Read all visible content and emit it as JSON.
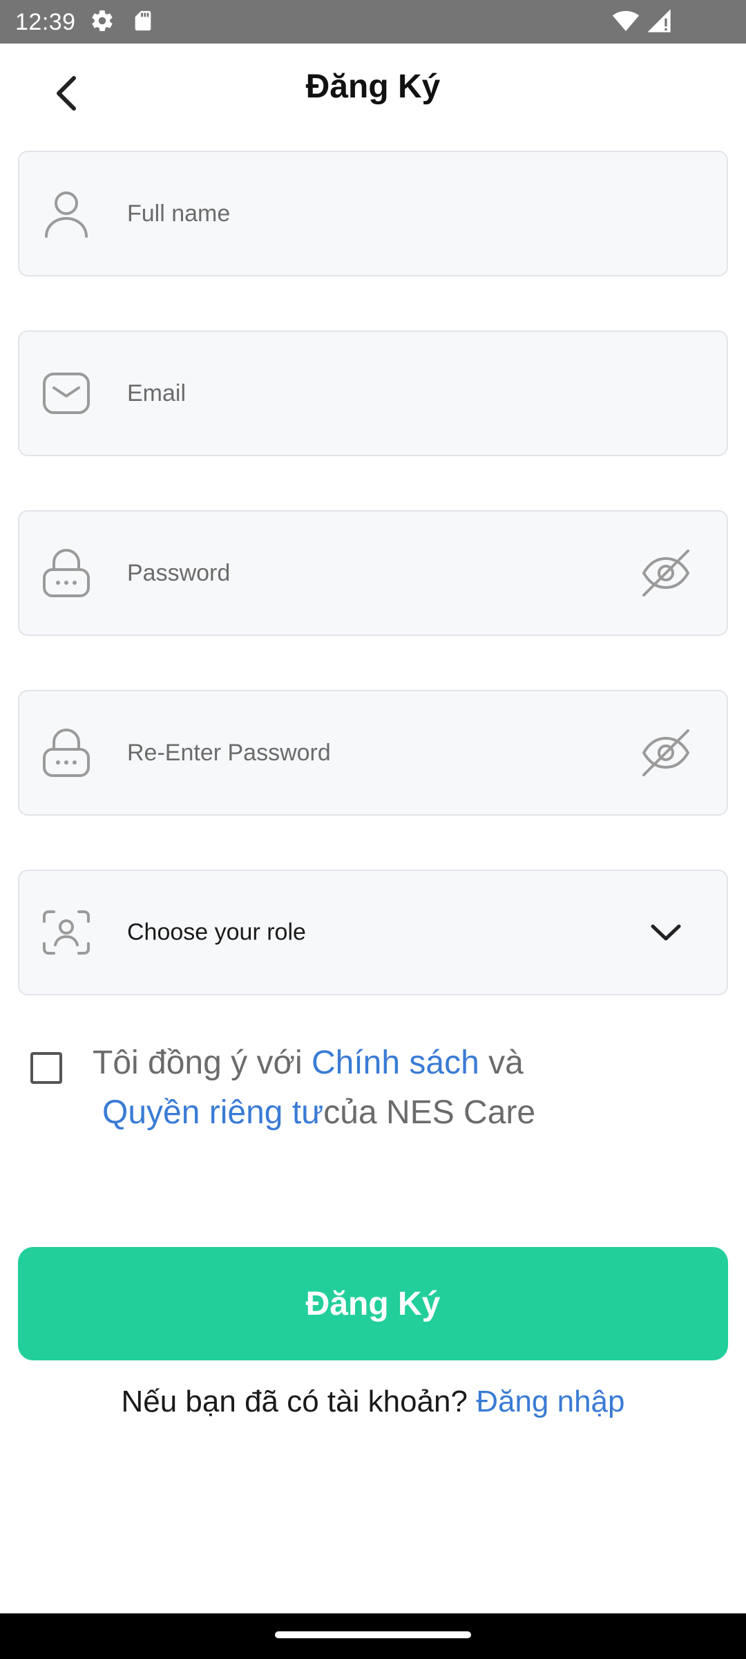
{
  "status_bar": {
    "time": "12:39"
  },
  "header": {
    "title": "Đăng Ký"
  },
  "form": {
    "full_name": {
      "placeholder": "Full name",
      "value": ""
    },
    "email": {
      "placeholder": "Email",
      "value": ""
    },
    "password": {
      "placeholder": "Password",
      "value": ""
    },
    "re_password": {
      "placeholder": "Re-Enter Password",
      "value": ""
    },
    "role": {
      "label": "Choose your role"
    }
  },
  "agreement": {
    "prefix": "Tôi đồng ý với ",
    "policy_link": "Chính sách",
    "middle": " và",
    "privacy_link": "Quyền riêng tư",
    "suffix": "của NES Care",
    "checked": false
  },
  "submit": {
    "label": "Đăng Ký"
  },
  "login_prompt": {
    "text": "Nếu bạn đã có tài khoản? ",
    "link": "Đăng nhập"
  },
  "icons": {
    "back": "chevron-left-icon",
    "user": "user-icon",
    "mail": "mail-icon",
    "lock": "lock-icon",
    "eye_off": "eye-off-icon",
    "role": "face-scan-icon",
    "dropdown": "chevron-down-icon"
  },
  "colors": {
    "accent": "#22cf9a",
    "link": "#3a7bd5",
    "field_bg": "#f7f8fa",
    "status_bar": "#757575"
  }
}
